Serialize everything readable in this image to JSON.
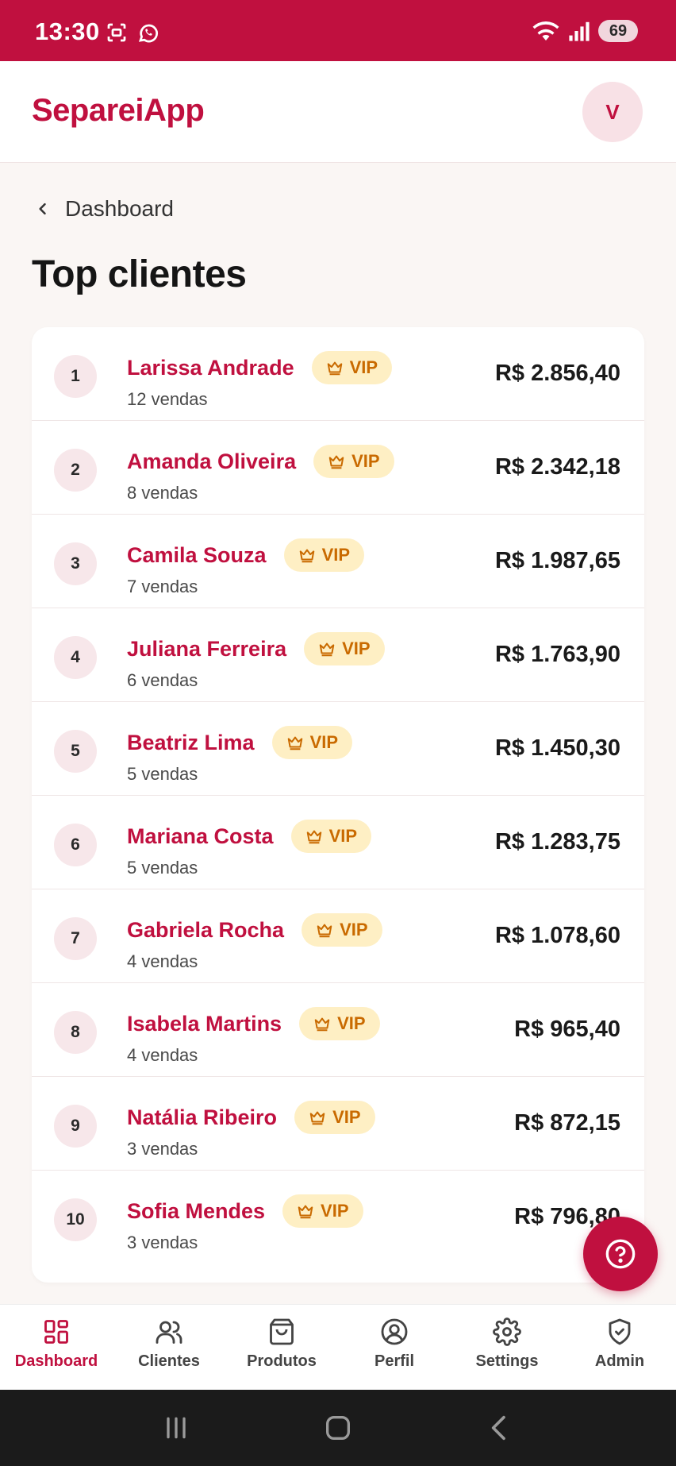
{
  "status_bar": {
    "time": "13:30",
    "battery": "69"
  },
  "header": {
    "brand": "SepareiApp",
    "avatar_initial": "V"
  },
  "breadcrumb": {
    "label": "Dashboard"
  },
  "page_title": "Top clientes",
  "vip_label": "VIP",
  "clients": [
    {
      "rank": "1",
      "name": "Larissa Andrade",
      "sales": "12 vendas",
      "amount": "R$ 2.856,40"
    },
    {
      "rank": "2",
      "name": "Amanda Oliveira",
      "sales": "8 vendas",
      "amount": "R$ 2.342,18"
    },
    {
      "rank": "3",
      "name": "Camila Souza",
      "sales": "7 vendas",
      "amount": "R$ 1.987,65"
    },
    {
      "rank": "4",
      "name": "Juliana Ferreira",
      "sales": "6 vendas",
      "amount": "R$ 1.763,90"
    },
    {
      "rank": "5",
      "name": "Beatriz Lima",
      "sales": "5 vendas",
      "amount": "R$ 1.450,30"
    },
    {
      "rank": "6",
      "name": "Mariana Costa",
      "sales": "5 vendas",
      "amount": "R$ 1.283,75"
    },
    {
      "rank": "7",
      "name": "Gabriela Rocha",
      "sales": "4 vendas",
      "amount": "R$ 1.078,60"
    },
    {
      "rank": "8",
      "name": "Isabela Martins",
      "sales": "4 vendas",
      "amount": "R$ 965,40"
    },
    {
      "rank": "9",
      "name": "Natália Ribeiro",
      "sales": "3 vendas",
      "amount": "R$ 872,15"
    },
    {
      "rank": "10",
      "name": "Sofia Mendes",
      "sales": "3 vendas",
      "amount": "R$ 796,80"
    }
  ],
  "bottom_nav": [
    {
      "label": "Dashboard",
      "icon": "grid-icon",
      "active": true
    },
    {
      "label": "Clientes",
      "icon": "users-icon",
      "active": false
    },
    {
      "label": "Produtos",
      "icon": "shopping-bag-icon",
      "active": false
    },
    {
      "label": "Perfil",
      "icon": "user-circle-icon",
      "active": false
    },
    {
      "label": "Settings",
      "icon": "gear-icon",
      "active": false
    },
    {
      "label": "Admin",
      "icon": "shield-check-icon",
      "active": false
    }
  ],
  "colors": {
    "primary": "#c0103f",
    "vip_bg": "#feefc4",
    "vip_text": "#c96a00",
    "background": "#faf6f4"
  }
}
